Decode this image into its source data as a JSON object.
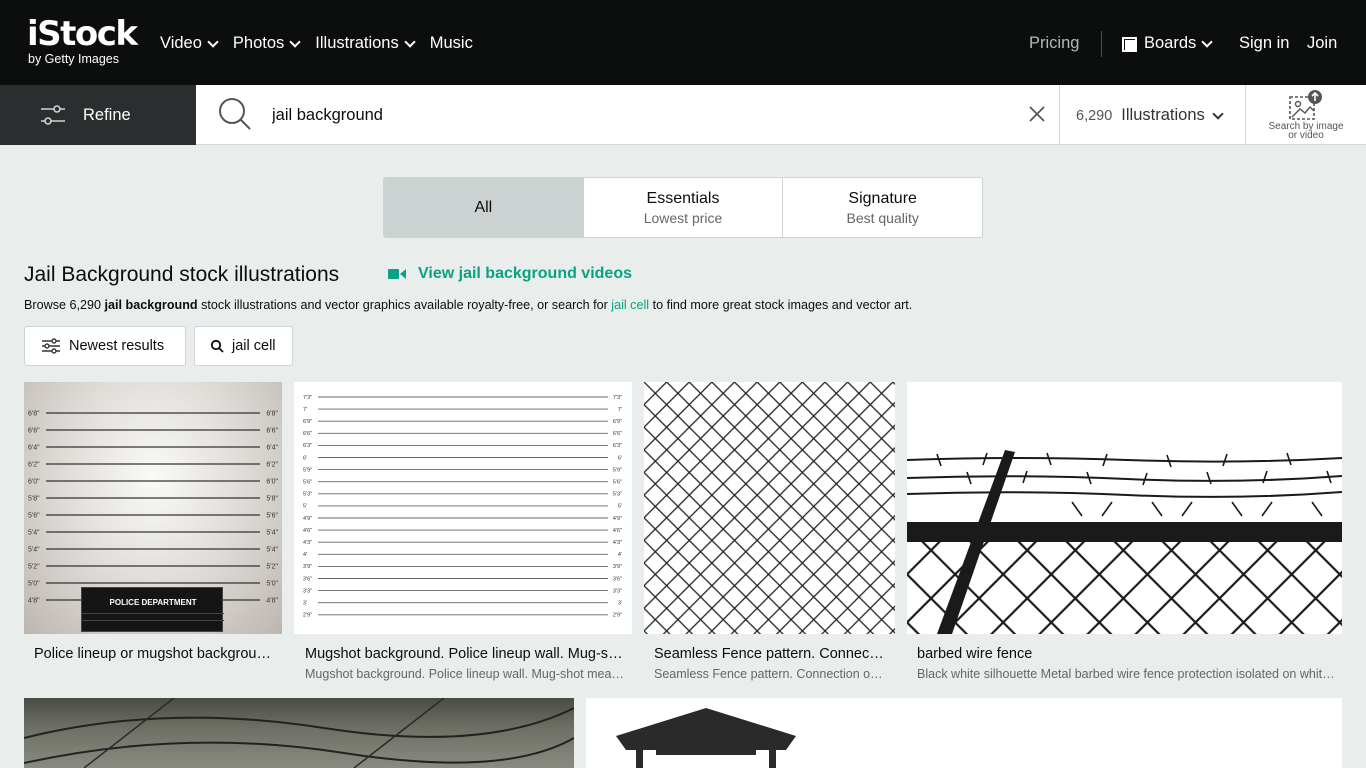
{
  "header": {
    "logo_main": "iStock",
    "logo_sub": "by Getty Images",
    "nav": [
      {
        "label": "Video",
        "dropdown": true
      },
      {
        "label": "Photos",
        "dropdown": true
      },
      {
        "label": "Illustrations",
        "dropdown": true
      },
      {
        "label": "Music",
        "dropdown": false
      }
    ],
    "pricing": "Pricing",
    "boards": "Boards",
    "signin": "Sign in",
    "join": "Join"
  },
  "search": {
    "refine_label": "Refine",
    "query": "jail background",
    "result_count": "6,290",
    "type_label": "Illustrations",
    "image_search_line1": "Search by image",
    "image_search_line2": "or video"
  },
  "segments": [
    {
      "title": "All",
      "subtitle": "",
      "active": true
    },
    {
      "title": "Essentials",
      "subtitle": "Lowest price",
      "active": false
    },
    {
      "title": "Signature",
      "subtitle": "Best quality",
      "active": false
    }
  ],
  "results": {
    "heading": "Jail Background stock illustrations",
    "videos_link": "View jail background videos",
    "desc_prefix": "Browse 6,290 ",
    "desc_bold": "jail background",
    "desc_mid": " stock illustrations and vector graphics available royalty-free, or search for ",
    "desc_link": "jail cell",
    "desc_suffix": " to find more great stock images and vector art.",
    "sort_label": "Newest results",
    "related_label": "jail cell"
  },
  "cards": [
    {
      "title": "Police lineup or mugshot background with a...",
      "subtitle": "",
      "thumb_text": "POLICE DEPARTMENT"
    },
    {
      "title": "Mugshot background. Police lineup wall. Mug-shot...",
      "subtitle": "Mugshot background. Police lineup wall. Mug-shot measure..."
    },
    {
      "title": "Seamless Fence pattern. Connection of metal...",
      "subtitle": "Seamless Fence pattern. Connection of metal grid..."
    },
    {
      "title": "barbed wire fence",
      "subtitle": "Black white silhouette Metal barbed wire fence protection isolated on white..."
    }
  ],
  "lineup1_labels": [
    "6'8\"",
    "6'6\"",
    "6'4\"",
    "6'2\"",
    "6'0\"",
    "5'8\"",
    "5'6\"",
    "5'4\"",
    "5'4\"",
    "5'2\"",
    "5'0\"",
    "4'8\""
  ],
  "lineup2_labels": [
    "7'3\"",
    "7'",
    "6'9\"",
    "6'6\"",
    "6'3\"",
    "6'",
    "5'9\"",
    "5'6\"",
    "5'3\"",
    "5'",
    "4'9\"",
    "4'6\"",
    "4'3\"",
    "4'",
    "3'9\"",
    "3'6\"",
    "3'3\"",
    "3'",
    "2'9\""
  ],
  "colors": {
    "accent": "#08a284",
    "topbar": "#0c0d0d",
    "refine_bg": "#2b2e2e",
    "page_bg": "#e9edec"
  }
}
